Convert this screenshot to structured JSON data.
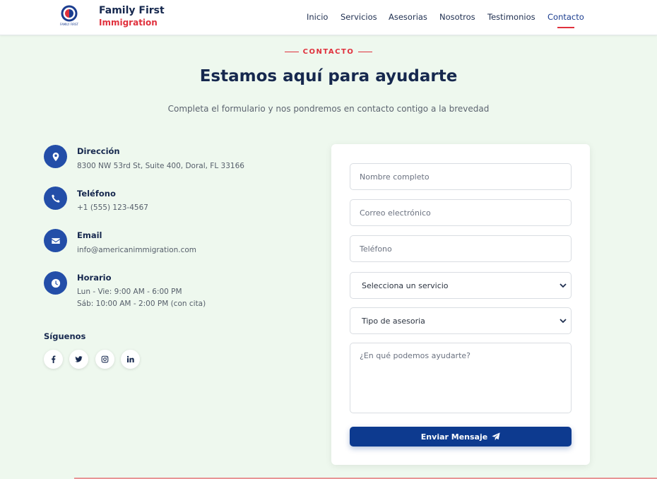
{
  "brand": {
    "line1": "Family First",
    "line2": "Immigration",
    "logo_icon": "family-first-logo",
    "logo_text": "FAMILY FIRST"
  },
  "nav": {
    "items": [
      {
        "label": "Inicio",
        "active": false
      },
      {
        "label": "Servicios",
        "active": false
      },
      {
        "label": "Asesorias",
        "active": false
      },
      {
        "label": "Nosotros",
        "active": false
      },
      {
        "label": "Testimonios",
        "active": false
      },
      {
        "label": "Contacto",
        "active": true
      }
    ]
  },
  "header": {
    "eyebrow": "CONTACTO",
    "title": "Estamos aquí para ayudarte",
    "subtitle": "Completa el formulario y nos pondremos en contacto contigo a la brevedad"
  },
  "contact": {
    "address": {
      "label": "Dirección",
      "value": "8300 NW 53rd St, Suite 400, Doral, FL 33166",
      "icon": "map-pin-icon"
    },
    "phone": {
      "label": "Teléfono",
      "value": "+1 (555) 123-4567",
      "icon": "phone-icon"
    },
    "email": {
      "label": "Email",
      "value": "info@americanimmigration.com",
      "icon": "envelope-icon"
    },
    "hours": {
      "label": "Horario",
      "line1": "Lun - Vie: 9:00 AM - 6:00 PM",
      "line2": "Sáb: 10:00 AM - 2:00 PM (con cita)",
      "icon": "clock-icon"
    }
  },
  "social": {
    "title": "Síguenos",
    "items": [
      "facebook-icon",
      "twitter-icon",
      "instagram-icon",
      "linkedin-icon"
    ]
  },
  "form": {
    "name_placeholder": "Nombre completo",
    "email_placeholder": "Correo electrónico",
    "phone_placeholder": "Teléfono",
    "service_selected": "Selecciona un servicio",
    "advice_selected": "Tipo de asesoria",
    "message_placeholder": "¿En qué podemos ayudarte?",
    "submit_label": "Enviar Mensaje",
    "submit_icon": "paper-plane-icon"
  },
  "colors": {
    "primary": "#0d3a8f",
    "accent": "#e0313d",
    "background": "#eef8ee",
    "text_dark": "#16284e"
  }
}
